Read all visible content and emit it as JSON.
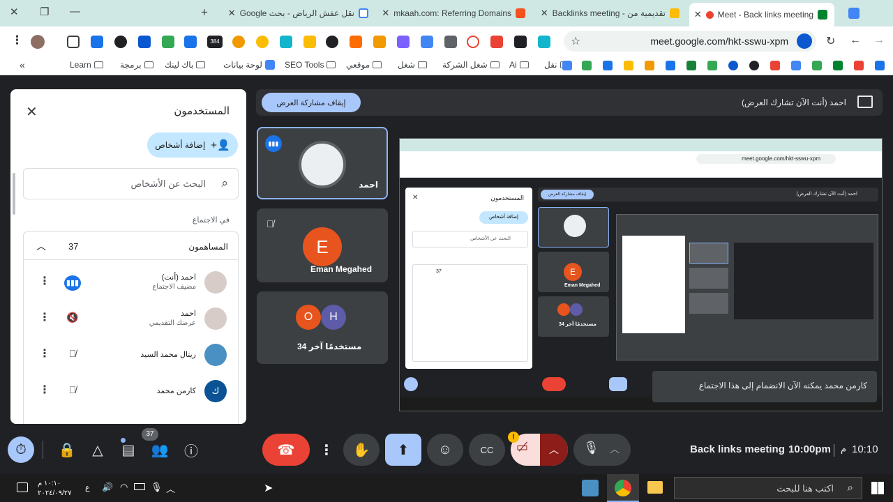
{
  "browser": {
    "tabs": [
      {
        "title": "نقل عفش الرياض - بحث Google",
        "active": false
      },
      {
        "title": "mkaah.com: Referring Domains",
        "active": false
      },
      {
        "title": "تقديمية من - Backlinks meeting",
        "active": false
      },
      {
        "title": "Meet - Back links meeting",
        "active": true
      }
    ],
    "url": "meet.google.com/hkt-sswu-xpm",
    "bookmarks": [
      "Learn",
      "برمجة",
      "باك لينك",
      "لوحة بيانات",
      "SEO Tools",
      "موقعي",
      "شغل",
      "شغل الشركة",
      "Ai",
      "نقل"
    ],
    "ext_badge": "384"
  },
  "people_panel": {
    "title": "المستخدمون",
    "add_people": "إضافة أشخاص",
    "search_placeholder": "البحث عن الأشخاص",
    "in_meeting": "في الاجتماع",
    "contributors_label": "المساهمون",
    "contributors_count": "37",
    "participants": [
      {
        "name": "احمد (أنت)",
        "role": "مضيف الاجتماع",
        "status": "speaking"
      },
      {
        "name": "احمد",
        "role": "عرضك التقديمي",
        "status": "muted"
      },
      {
        "name": "ريتال محمد السيد",
        "role": "",
        "status": "muted"
      },
      {
        "name": "كارمن محمد",
        "role": "",
        "status": "muted"
      }
    ]
  },
  "presenting": {
    "stop_label": "إيقاف مشاركة العرض",
    "status_text": "احمد (أنت الآن تشارك العرض)"
  },
  "tiles": [
    {
      "name": "احمد"
    },
    {
      "name": "Eman Megahed",
      "initial": "E"
    },
    {
      "label": "34 مستخدمًا آخر",
      "initials": [
        "O",
        "H"
      ]
    }
  ],
  "shared_screen": {
    "mini_url": "meet.google.com/hkt-sswu-xpm",
    "toast": "كارمن محمد يمكنه الآن الانضمام إلى هذا الاجتماع",
    "mini_panel_title": "المستخدمون",
    "mini_add": "إضافة أشخاص",
    "mini_search": "البحث عن الأشخاص",
    "mini_count": "37",
    "mini_stop": "إيقاف مشاركة العرض",
    "mini_presenter": "احمد (أنت الآن تشارك العرض)",
    "mini_tile2": "Eman Megahed",
    "mini_tile3": "34 مستخدمًا آخر"
  },
  "controls": {
    "people_badge": "37",
    "meeting_name": "Back links meeting",
    "meeting_time": "10:00pm",
    "clock": "10:10",
    "am_pm": "م"
  },
  "taskbar": {
    "search_placeholder": "اكتب هنا للبحث",
    "time": "١٠:١٠ م",
    "date": "٢٠٢٤/٠٩/٢٧",
    "lang": "ع"
  },
  "colors": {
    "accent_blue": "#a8c7fa",
    "end_call_red": "#ea4335",
    "tile_bg": "#3c4043",
    "avatar_orange": "#e8541e",
    "avatar_purple": "#5e5ba8"
  }
}
